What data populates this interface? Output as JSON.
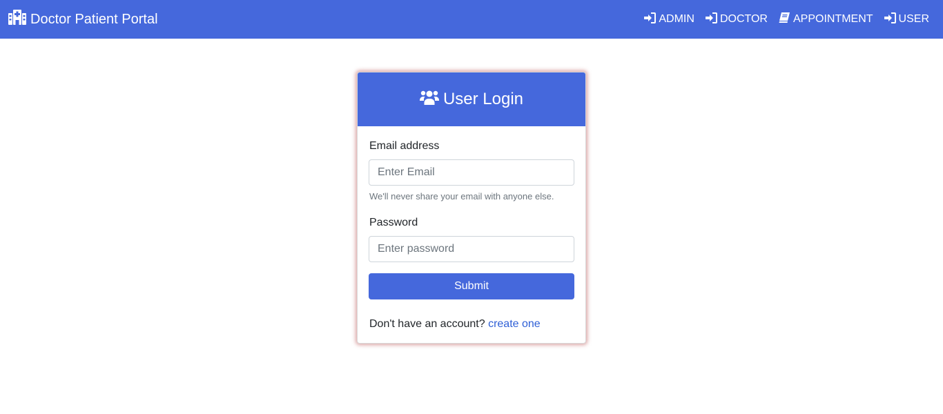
{
  "navbar": {
    "brand_label": "Doctor Patient Portal",
    "brand_icon": "hospital-icon",
    "links": [
      {
        "label": "ADMIN",
        "icon": "sign-in-icon"
      },
      {
        "label": "DOCTOR",
        "icon": "sign-in-icon"
      },
      {
        "label": "APPOINTMENT",
        "icon": "book-icon"
      },
      {
        "label": "USER",
        "icon": "sign-in-icon"
      }
    ]
  },
  "login": {
    "title": "User Login",
    "title_icon": "users-icon",
    "email_label": "Email address",
    "email_placeholder": "Enter Email",
    "email_value": "",
    "email_help": "We'll never share your email with anyone else.",
    "password_label": "Password",
    "password_placeholder": "Enter password",
    "password_value": "",
    "submit_label": "Submit",
    "signup_prompt": "Don't have an account?",
    "signup_link": "create one"
  },
  "colors": {
    "primary": "#4568dc",
    "link": "#2e5fd6",
    "card_glow": "#be5a5a"
  }
}
